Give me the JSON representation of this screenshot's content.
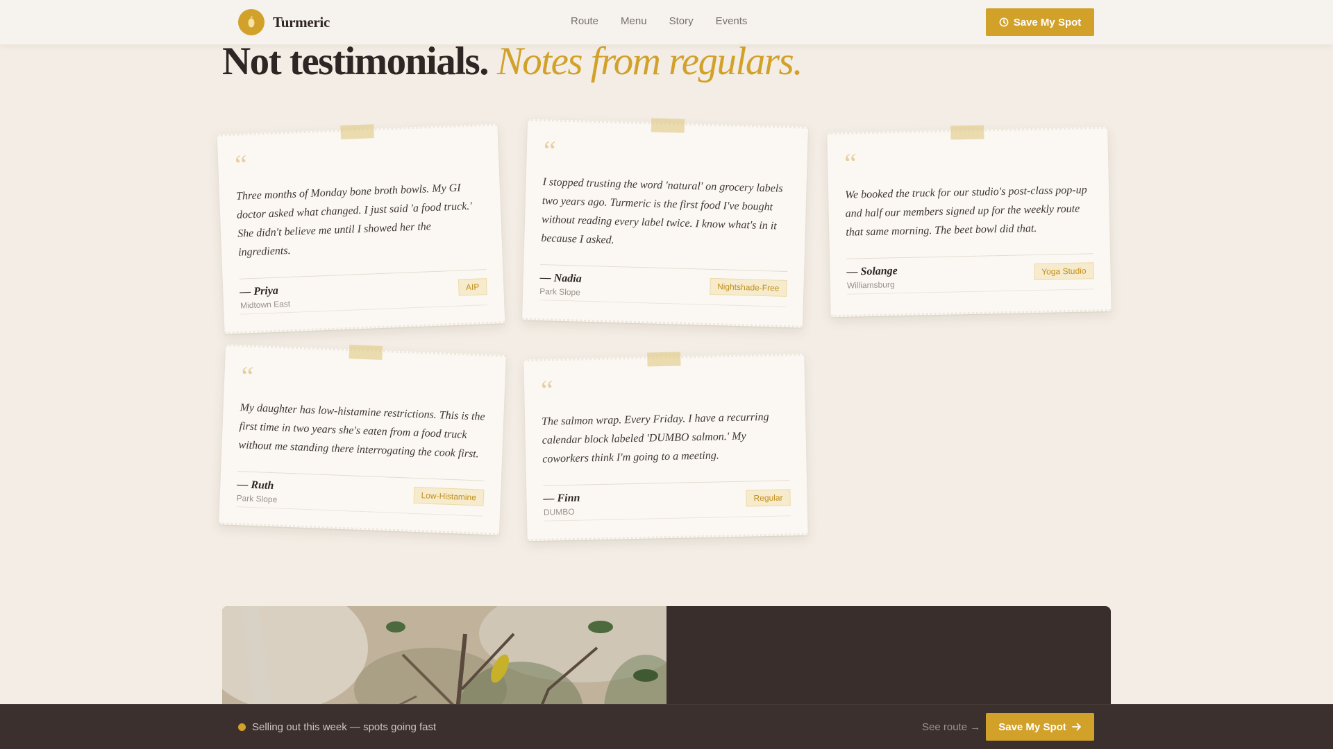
{
  "brand": {
    "name": "Turmeric",
    "logo_icon": "turmeric-root-icon",
    "accent_color": "#d2a12a"
  },
  "nav": {
    "links": [
      "Route",
      "Menu",
      "Story",
      "Events"
    ],
    "cta_label": "Save My Spot",
    "cta_icon": "clock-icon"
  },
  "heading": {
    "strong": "Not testimonials.",
    "emphasis": "Notes from regulars."
  },
  "notes": [
    {
      "quote_mark": "“",
      "text": "Three months of Monday bone broth bowls. My GI doctor asked what changed. I just said 'a food truck.' She didn't believe me until I showed her the ingredients.",
      "author": "— Priya",
      "neighborhood": "Midtown East",
      "tag": "AIP"
    },
    {
      "quote_mark": "“",
      "text": "I stopped trusting the word 'natural' on grocery labels two years ago. Turmeric is the first food I've bought without reading every label twice. I know what's in it because I asked.",
      "author": "— Nadia",
      "neighborhood": "Park Slope",
      "tag": "Nightshade-Free"
    },
    {
      "quote_mark": "“",
      "text": "We booked the truck for our studio's post-class pop-up and half our members signed up for the weekly route that same morning. The beet bowl did that.",
      "author": "— Solange",
      "neighborhood": "Williamsburg",
      "tag": "Yoga Studio"
    },
    {
      "quote_mark": "“",
      "text": "My daughter has low-histamine restrictions. This is the first time in two years she's eaten from a food truck without me standing there interrogating the cook first.",
      "author": "— Ruth",
      "neighborhood": "Park Slope",
      "tag": "Low-Histamine"
    },
    {
      "quote_mark": "“",
      "text": "The salmon wrap. Every Friday. I have a recurring calendar block labeled 'DUMBO salmon.' My coworkers think I'm going to a meeting.",
      "author": "— Finn",
      "neighborhood": "DUMBO",
      "tag": "Regular"
    }
  ],
  "sticky_bar": {
    "status_text": "Selling out this week — spots going fast",
    "see_route_label": "See route →",
    "cta_label": "Save My Spot",
    "cta_icon": "arrow-right-icon"
  }
}
